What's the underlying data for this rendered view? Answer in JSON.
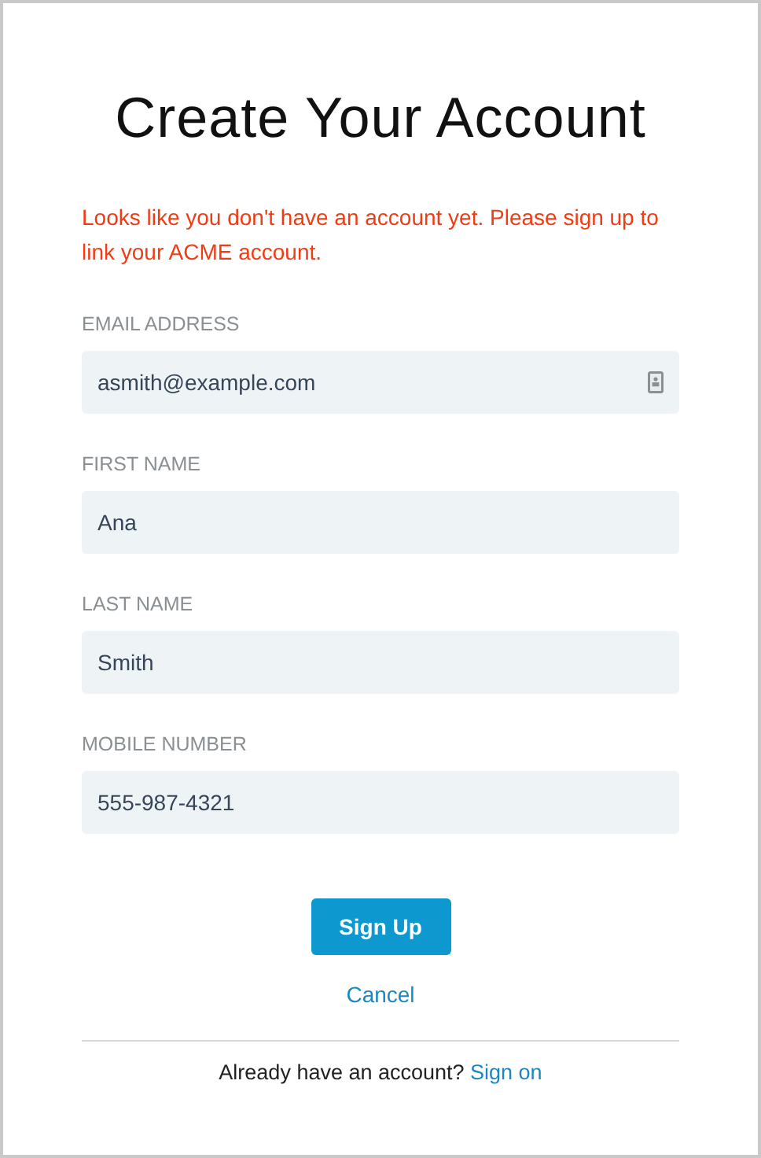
{
  "title": "Create Your Account",
  "message": "Looks like you don't have an account yet. Please sign up to link your ACME account.",
  "fields": [
    {
      "kind": "email",
      "label": "EMAIL ADDRESS",
      "value": "asmith@example.com"
    },
    {
      "kind": "text",
      "label": "FIRST NAME",
      "value": "Ana"
    },
    {
      "kind": "text",
      "label": "LAST NAME",
      "value": "Smith"
    },
    {
      "kind": "text",
      "label": "MOBILE NUMBER",
      "value": "555-987-4321"
    }
  ],
  "submit": "Sign Up",
  "cancel": "Cancel",
  "footer": {
    "text": "Already have an account?",
    "link": "Sign on"
  }
}
